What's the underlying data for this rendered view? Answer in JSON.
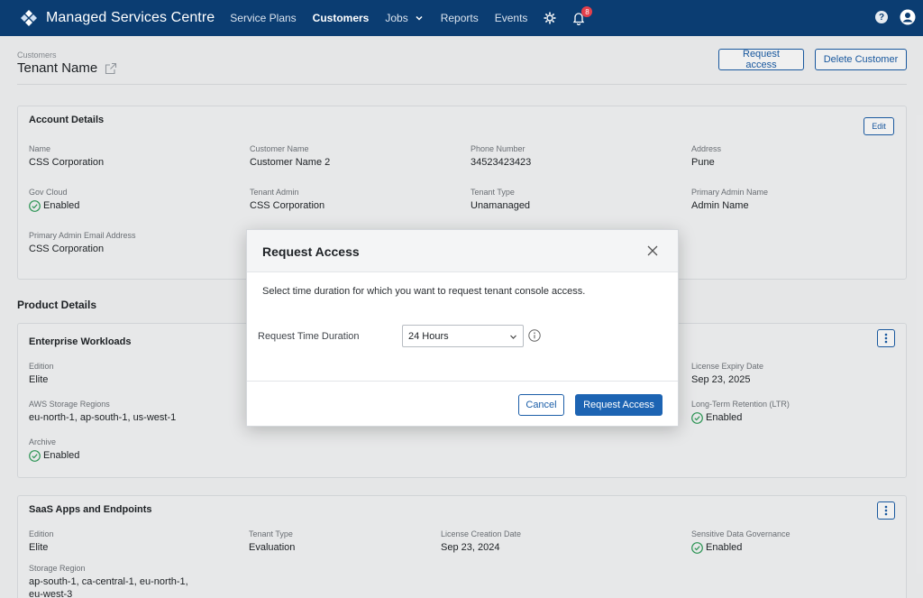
{
  "app": {
    "title": "Managed Services Centre"
  },
  "nav": {
    "items": [
      "Service Plans",
      "Customers",
      "Jobs",
      "Reports",
      "Events"
    ],
    "active": "Customers",
    "notification_count": "8"
  },
  "header": {
    "breadcrumb": "Customers",
    "title": "Tenant Name",
    "request_access_label": "Request access",
    "delete_customer_label": "Delete Customer"
  },
  "account": {
    "title": "Account Details",
    "edit_label": "Edit",
    "fields": [
      {
        "label": "Name",
        "value": "CSS Corporation"
      },
      {
        "label": "Customer Name",
        "value": "Customer Name 2"
      },
      {
        "label": "Phone Number",
        "value": "34523423423"
      },
      {
        "label": "Address",
        "value": "Pune"
      },
      {
        "label": "Gov Cloud",
        "value": "Enabled"
      },
      {
        "label": "Tenant Admin",
        "value": "CSS Corporation"
      },
      {
        "label": "Tenant Type",
        "value": "Unamanaged"
      },
      {
        "label": "Primary Admin Name",
        "value": "Admin Name"
      },
      {
        "label": "Primary Admin Email Address",
        "value": "CSS Corporation"
      }
    ]
  },
  "products": {
    "title": "Product Details",
    "enterprise": {
      "title": "Enterprise Workloads",
      "fields": [
        {
          "label": "Edition",
          "value": "Elite"
        },
        {
          "label": "License Expiry Date",
          "value": "Sep 23, 2025"
        },
        {
          "label": "AWS Storage Regions",
          "value": "eu-north-1, ap-south-1, us-west-1"
        },
        {
          "label": "Long-Term Retention (LTR)",
          "value": "Enabled"
        },
        {
          "label": "Archive",
          "value": "Enabled"
        }
      ]
    },
    "saas": {
      "title": "SaaS Apps and Endpoints",
      "fields": [
        {
          "label": "Edition",
          "value": "Elite"
        },
        {
          "label": "Tenant Type",
          "value": "Evaluation"
        },
        {
          "label": "License Creation Date",
          "value": "Sep 23, 2024"
        },
        {
          "label": "Sensitive Data Governance",
          "value": "Enabled"
        },
        {
          "label": "Storage Region",
          "value": "ap-south-1, ca-central-1, eu-north-1,"
        },
        {
          "label": "",
          "value": "eu-west-3"
        }
      ]
    }
  },
  "modal": {
    "title": "Request Access",
    "description": "Select time duration for which you want to request tenant console access.",
    "duration_label": "Request Time Duration",
    "duration_value": "24 Hours",
    "cancel_label": "Cancel",
    "submit_label": "Request Access"
  },
  "colors": {
    "nav_bg": "#0b3d72",
    "accent": "#1d64b3",
    "success": "#2f9e5a",
    "badge": "#e5404b"
  },
  "icons": [
    "app-logo-icon",
    "chevron-down-icon",
    "gear-icon",
    "bell-icon",
    "help-icon",
    "user-icon",
    "external-link-icon",
    "check-circle-icon",
    "kebab-menu-icon",
    "close-icon",
    "info-icon"
  ]
}
